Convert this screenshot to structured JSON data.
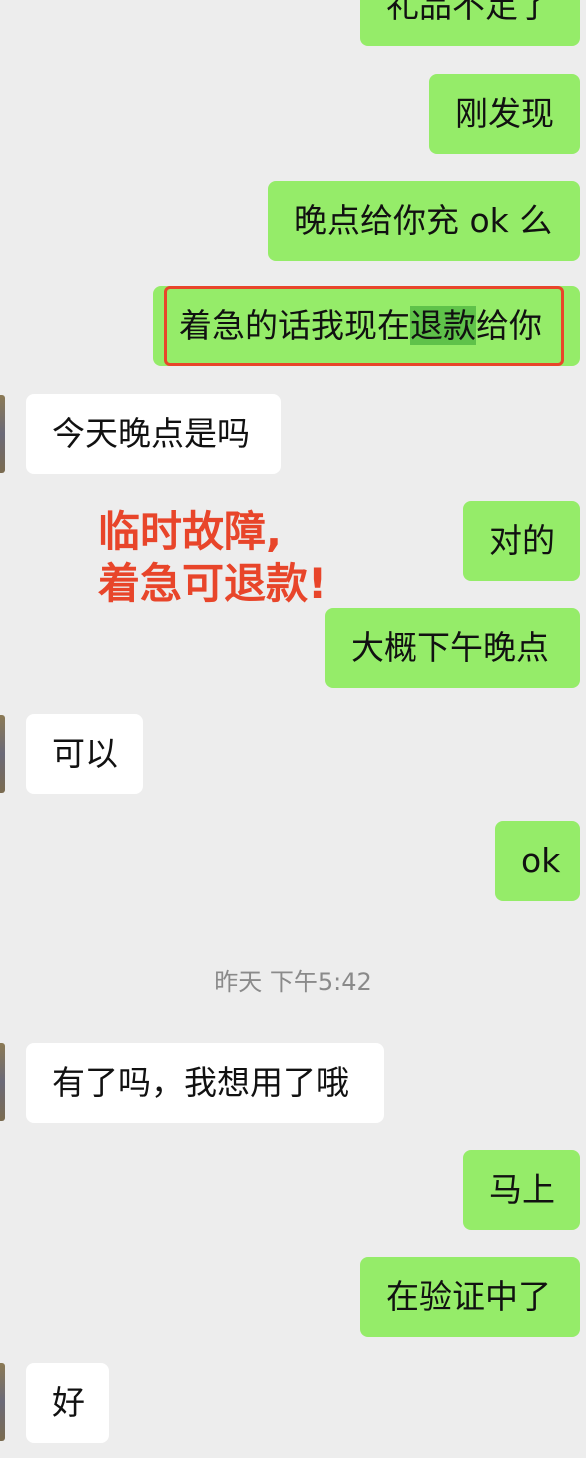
{
  "messages": {
    "m0": "礼品不足了",
    "m1": "刚发现",
    "m2": "晚点给你充 ok 么",
    "m3_pre": "着急的话我现在",
    "m3_hl": "退款",
    "m3_post": "给你",
    "m4": "今天晚点是吗",
    "m5": "对的",
    "m6": "大概下午晚点",
    "m7": "可以",
    "m8": "ok",
    "m9": "有了吗，我想用了哦",
    "m10": "马上",
    "m11": "在验证中了",
    "m12": "好"
  },
  "timestamp": "昨天 下午5:42",
  "annotation": {
    "line1": "临时故障,",
    "line2": "着急可退款!"
  },
  "colors": {
    "background": "#ededed",
    "outgoing_bubble": "#95ec69",
    "incoming_bubble": "#ffffff",
    "annotation": "#e8452a",
    "highlight": "#5fc24a"
  }
}
